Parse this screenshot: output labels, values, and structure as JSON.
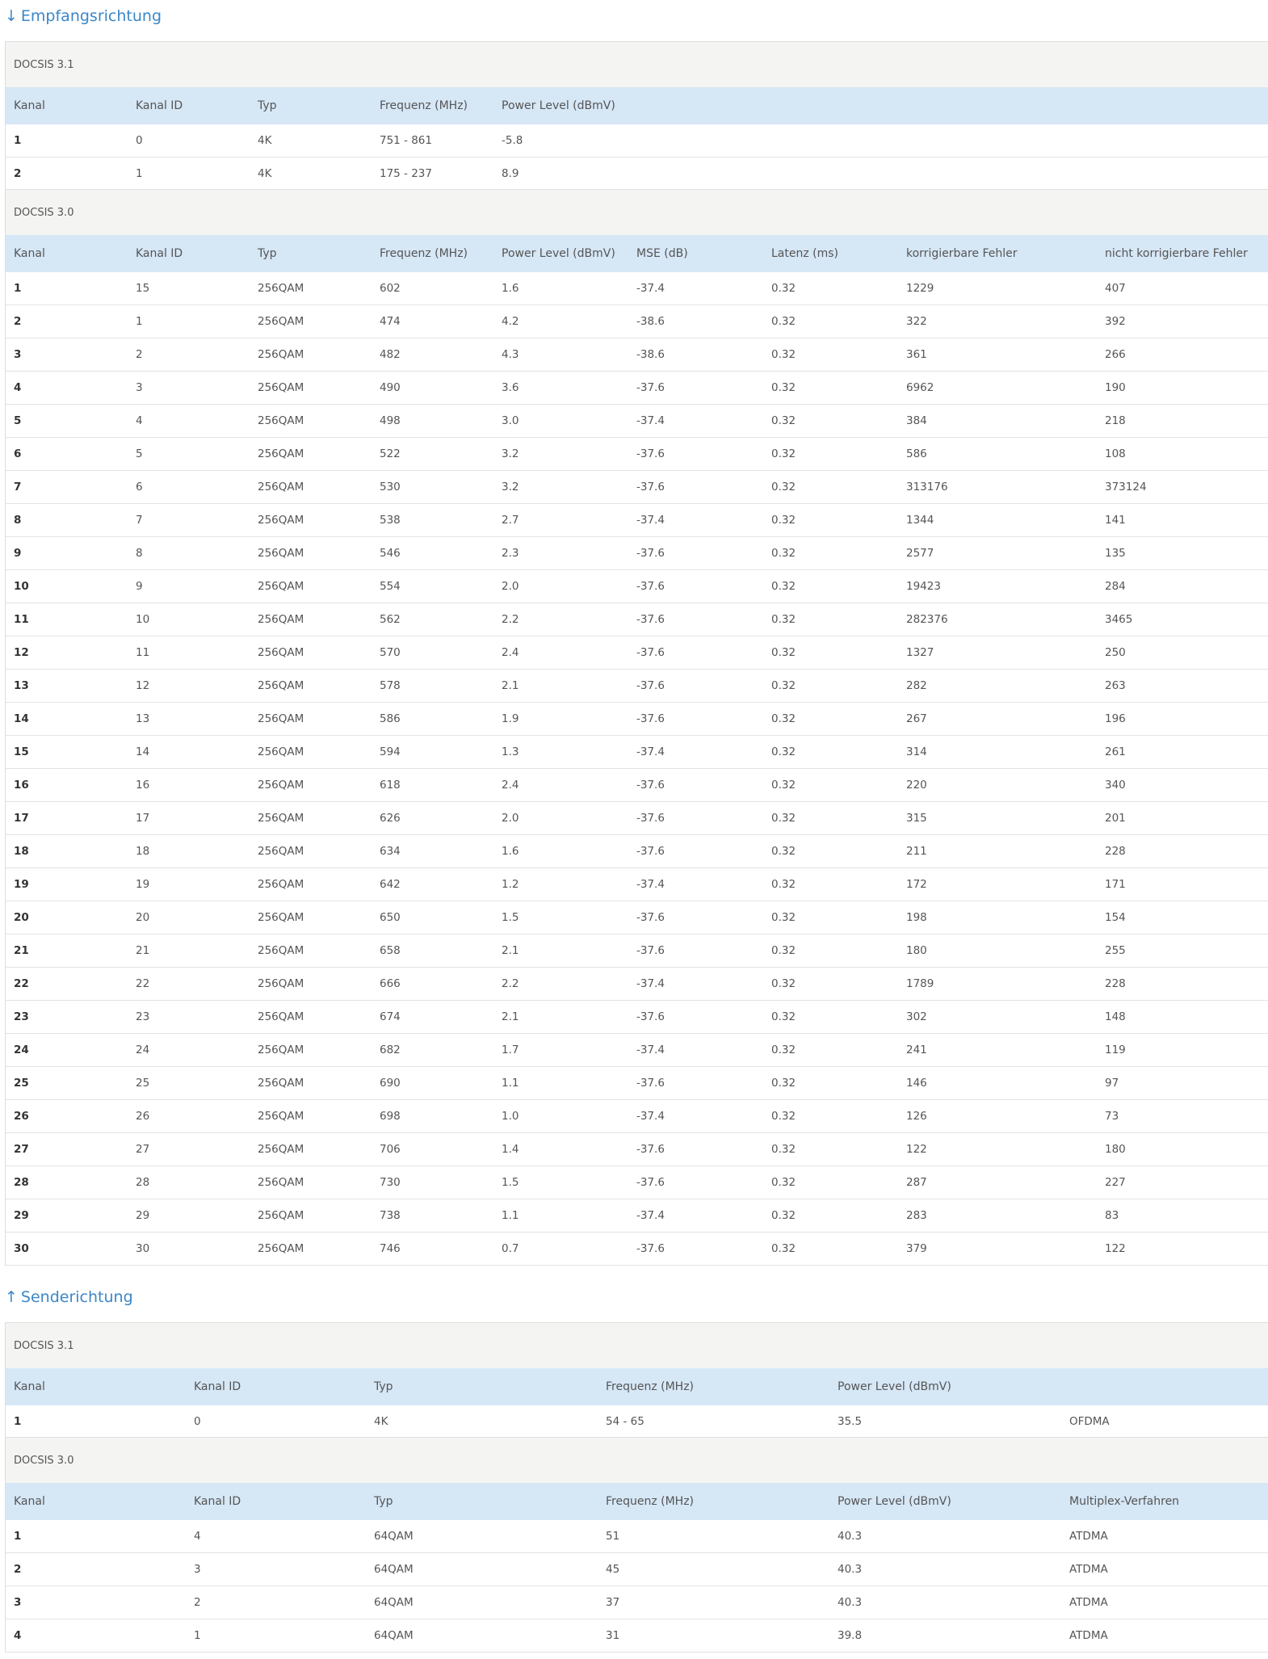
{
  "downstream": {
    "title": "Empfangsrichtung",
    "arrow": "↓",
    "docsis31": {
      "caption": "DOCSIS 3.1",
      "headers": [
        "Kanal",
        "Kanal ID",
        "Typ",
        "Frequenz (MHz)",
        "Power Level (dBmV)"
      ],
      "rows": [
        [
          "1",
          "0",
          "4K",
          "751 - 861",
          "-5.8"
        ],
        [
          "2",
          "1",
          "4K",
          "175 - 237",
          "8.9"
        ]
      ]
    },
    "docsis30": {
      "caption": "DOCSIS 3.0",
      "headers": [
        "Kanal",
        "Kanal ID",
        "Typ",
        "Frequenz (MHz)",
        "Power Level (dBmV)",
        "MSE (dB)",
        "Latenz (ms)",
        "korrigierbare Fehler",
        "nicht korrigierbare Fehler"
      ],
      "rows": [
        [
          "1",
          "15",
          "256QAM",
          "602",
          "1.6",
          "-37.4",
          "0.32",
          "1229",
          "407"
        ],
        [
          "2",
          "1",
          "256QAM",
          "474",
          "4.2",
          "-38.6",
          "0.32",
          "322",
          "392"
        ],
        [
          "3",
          "2",
          "256QAM",
          "482",
          "4.3",
          "-38.6",
          "0.32",
          "361",
          "266"
        ],
        [
          "4",
          "3",
          "256QAM",
          "490",
          "3.6",
          "-37.6",
          "0.32",
          "6962",
          "190"
        ],
        [
          "5",
          "4",
          "256QAM",
          "498",
          "3.0",
          "-37.4",
          "0.32",
          "384",
          "218"
        ],
        [
          "6",
          "5",
          "256QAM",
          "522",
          "3.2",
          "-37.6",
          "0.32",
          "586",
          "108"
        ],
        [
          "7",
          "6",
          "256QAM",
          "530",
          "3.2",
          "-37.6",
          "0.32",
          "313176",
          "373124"
        ],
        [
          "8",
          "7",
          "256QAM",
          "538",
          "2.7",
          "-37.4",
          "0.32",
          "1344",
          "141"
        ],
        [
          "9",
          "8",
          "256QAM",
          "546",
          "2.3",
          "-37.6",
          "0.32",
          "2577",
          "135"
        ],
        [
          "10",
          "9",
          "256QAM",
          "554",
          "2.0",
          "-37.6",
          "0.32",
          "19423",
          "284"
        ],
        [
          "11",
          "10",
          "256QAM",
          "562",
          "2.2",
          "-37.6",
          "0.32",
          "282376",
          "3465"
        ],
        [
          "12",
          "11",
          "256QAM",
          "570",
          "2.4",
          "-37.6",
          "0.32",
          "1327",
          "250"
        ],
        [
          "13",
          "12",
          "256QAM",
          "578",
          "2.1",
          "-37.6",
          "0.32",
          "282",
          "263"
        ],
        [
          "14",
          "13",
          "256QAM",
          "586",
          "1.9",
          "-37.6",
          "0.32",
          "267",
          "196"
        ],
        [
          "15",
          "14",
          "256QAM",
          "594",
          "1.3",
          "-37.4",
          "0.32",
          "314",
          "261"
        ],
        [
          "16",
          "16",
          "256QAM",
          "618",
          "2.4",
          "-37.6",
          "0.32",
          "220",
          "340"
        ],
        [
          "17",
          "17",
          "256QAM",
          "626",
          "2.0",
          "-37.6",
          "0.32",
          "315",
          "201"
        ],
        [
          "18",
          "18",
          "256QAM",
          "634",
          "1.6",
          "-37.6",
          "0.32",
          "211",
          "228"
        ],
        [
          "19",
          "19",
          "256QAM",
          "642",
          "1.2",
          "-37.4",
          "0.32",
          "172",
          "171"
        ],
        [
          "20",
          "20",
          "256QAM",
          "650",
          "1.5",
          "-37.6",
          "0.32",
          "198",
          "154"
        ],
        [
          "21",
          "21",
          "256QAM",
          "658",
          "2.1",
          "-37.6",
          "0.32",
          "180",
          "255"
        ],
        [
          "22",
          "22",
          "256QAM",
          "666",
          "2.2",
          "-37.4",
          "0.32",
          "1789",
          "228"
        ],
        [
          "23",
          "23",
          "256QAM",
          "674",
          "2.1",
          "-37.6",
          "0.32",
          "302",
          "148"
        ],
        [
          "24",
          "24",
          "256QAM",
          "682",
          "1.7",
          "-37.4",
          "0.32",
          "241",
          "119"
        ],
        [
          "25",
          "25",
          "256QAM",
          "690",
          "1.1",
          "-37.6",
          "0.32",
          "146",
          "97"
        ],
        [
          "26",
          "26",
          "256QAM",
          "698",
          "1.0",
          "-37.4",
          "0.32",
          "126",
          "73"
        ],
        [
          "27",
          "27",
          "256QAM",
          "706",
          "1.4",
          "-37.6",
          "0.32",
          "122",
          "180"
        ],
        [
          "28",
          "28",
          "256QAM",
          "730",
          "1.5",
          "-37.6",
          "0.32",
          "287",
          "227"
        ],
        [
          "29",
          "29",
          "256QAM",
          "738",
          "1.1",
          "-37.4",
          "0.32",
          "283",
          "83"
        ],
        [
          "30",
          "30",
          "256QAM",
          "746",
          "0.7",
          "-37.6",
          "0.32",
          "379",
          "122"
        ]
      ]
    }
  },
  "upstream": {
    "title": "Senderichtung",
    "arrow": "↑",
    "docsis31": {
      "caption": "DOCSIS 3.1",
      "headers": [
        "Kanal",
        "Kanal ID",
        "Typ",
        "Frequenz (MHz)",
        "Power Level (dBmV)",
        ""
      ],
      "rows": [
        [
          "1",
          "0",
          "4K",
          "54 - 65",
          "35.5",
          "OFDMA"
        ]
      ]
    },
    "docsis30": {
      "caption": "DOCSIS 3.0",
      "headers": [
        "Kanal",
        "Kanal ID",
        "Typ",
        "Frequenz (MHz)",
        "Power Level (dBmV)",
        "Multiplex-Verfahren"
      ],
      "rows": [
        [
          "1",
          "4",
          "64QAM",
          "51",
          "40.3",
          "ATDMA"
        ],
        [
          "2",
          "3",
          "64QAM",
          "45",
          "40.3",
          "ATDMA"
        ],
        [
          "3",
          "2",
          "64QAM",
          "37",
          "40.3",
          "ATDMA"
        ],
        [
          "4",
          "1",
          "64QAM",
          "31",
          "39.8",
          "ATDMA"
        ]
      ]
    }
  }
}
